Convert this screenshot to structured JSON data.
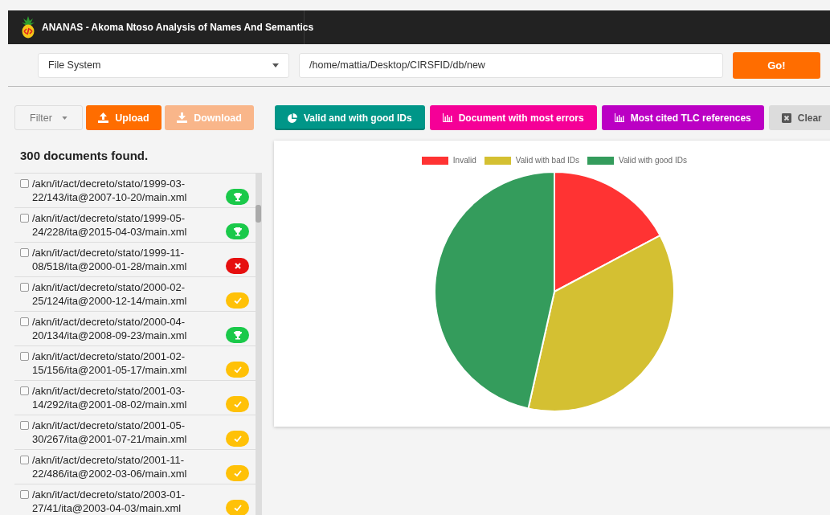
{
  "header": {
    "title": "ANANAS - Akoma Ntoso Analysis of Names And Semantics"
  },
  "source_select": {
    "value": "File System"
  },
  "path_field": {
    "value": "/home/mattia/Desktop/CIRSFID/db/new"
  },
  "go_button": {
    "label": "Go!"
  },
  "toolbar": [
    {
      "kind": "filter",
      "label": "Filter",
      "disabled": false
    },
    {
      "kind": "upload",
      "label": "Upload",
      "disabled": false
    },
    {
      "kind": "download",
      "label": "Download",
      "disabled": true
    }
  ],
  "chart_buttons": [
    {
      "kind": "pie",
      "label": "Valid and with good IDs",
      "color": "#009688",
      "selected": true
    },
    {
      "kind": "bars",
      "label": "Document with most errors",
      "color": "#f50097",
      "selected": false
    },
    {
      "kind": "bars",
      "label": "Most cited TLC references",
      "color": "#bb00c4",
      "selected": false
    },
    {
      "kind": "clear",
      "label": "Clear",
      "color": "#dcdcdc",
      "selected": false
    }
  ],
  "results_count": "300 documents found.",
  "documents": [
    {
      "path": "/akn/it/act/decreto/stato/1999-03-22/143/ita@2007-10-20/main.xml",
      "checked": false,
      "kind": "trophy"
    },
    {
      "path": "/akn/it/act/decreto/stato/1999-05-24/228/ita@2015-04-03/main.xml",
      "checked": false,
      "kind": "trophy"
    },
    {
      "path": "/akn/it/act/decreto/stato/1999-11-08/518/ita@2000-01-28/main.xml",
      "checked": false,
      "kind": "error"
    },
    {
      "path": "/akn/it/act/decreto/stato/2000-02-25/124/ita@2000-12-14/main.xml",
      "checked": false,
      "kind": "check"
    },
    {
      "path": "/akn/it/act/decreto/stato/2000-04-20/134/ita@2008-09-23/main.xml",
      "checked": false,
      "kind": "trophy"
    },
    {
      "path": "/akn/it/act/decreto/stato/2001-02-15/156/ita@2001-05-17/main.xml",
      "checked": false,
      "kind": "check"
    },
    {
      "path": "/akn/it/act/decreto/stato/2001-03-14/292/ita@2001-08-02/main.xml",
      "checked": false,
      "kind": "check"
    },
    {
      "path": "/akn/it/act/decreto/stato/2001-05-30/267/ita@2001-07-21/main.xml",
      "checked": false,
      "kind": "check"
    },
    {
      "path": "/akn/it/act/decreto/stato/2001-11-22/486/ita@2002-03-06/main.xml",
      "checked": false,
      "kind": "check"
    },
    {
      "path": "/akn/it/act/decreto/stato/2003-01-27/41/ita@2003-04-03/main.xml",
      "checked": false,
      "kind": "check"
    }
  ],
  "chart_legend": [
    {
      "label": "Invalid",
      "color": "#ff3333"
    },
    {
      "label": "Valid with bad IDs",
      "color": "#d4c032"
    },
    {
      "label": "Valid with good IDs",
      "color": "#349c5c"
    }
  ]
}
